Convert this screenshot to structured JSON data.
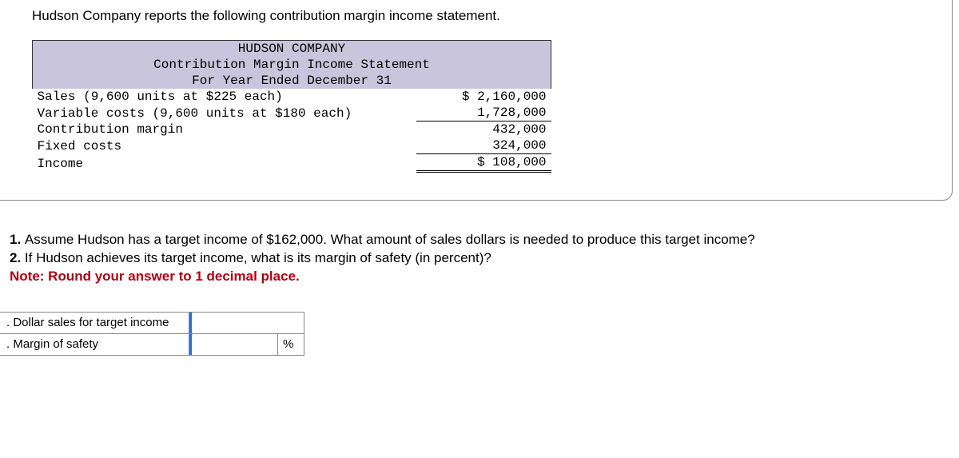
{
  "intro": "Hudson Company reports the following contribution margin income statement.",
  "statement": {
    "header1": "HUDSON COMPANY",
    "header2": "Contribution Margin Income Statement",
    "header3": "For Year Ended December 31",
    "rows": [
      {
        "label": "Sales (9,600 units at $225 each)",
        "amount": "$ 2,160,000",
        "top": false,
        "bot": false
      },
      {
        "label": "Variable costs (9,600 units at $180 each)",
        "amount": "1,728,000",
        "top": false,
        "bot": true
      },
      {
        "label": "Contribution margin",
        "amount": "432,000",
        "top": false,
        "bot": false
      },
      {
        "label": "Fixed costs",
        "amount": "324,000",
        "top": false,
        "bot": true
      },
      {
        "label": "Income",
        "amount": "$ 108,000",
        "top": false,
        "bot": "dbl"
      }
    ]
  },
  "questions": {
    "q1_prefix": "1. ",
    "q1": "Assume Hudson has a target income of $162,000. What amount of sales dollars is needed to produce this target income?",
    "q2_prefix": "2. ",
    "q2": "If Hudson achieves its target income, what is its margin of safety (in percent)?",
    "note": "Note: Round your answer to 1 decimal place."
  },
  "answers": {
    "row1_num": ".",
    "row1_label": "Dollar sales for target income",
    "row2_num": ".",
    "row2_label": "Margin of safety",
    "unit_percent": "%"
  }
}
